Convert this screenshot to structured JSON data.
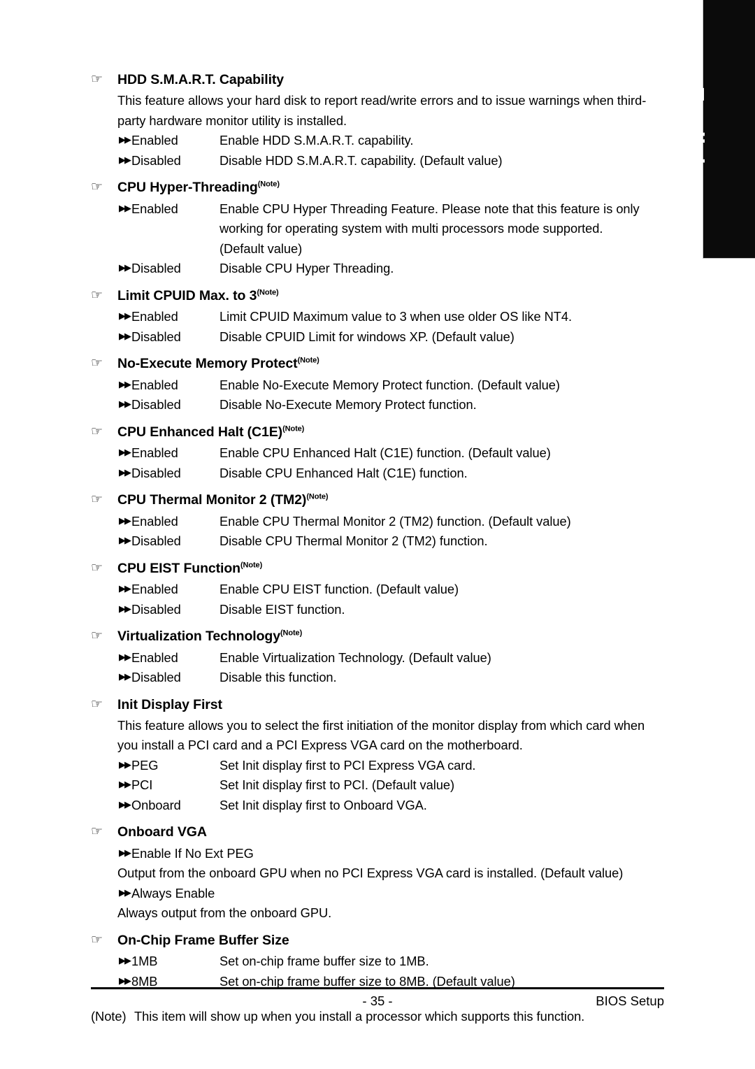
{
  "language_tab": {
    "label": "English"
  },
  "icons": {
    "manicule": "☞",
    "double_arrow": "▶▶"
  },
  "sections": [
    {
      "id": "hdd-smart-capability",
      "title": "HDD S.M.A.R.T. Capability",
      "note_marker": "",
      "paragraphs": [
        "This feature allows your hard disk to report read/write errors and to issue warnings when third-party hardware monitor utility is installed."
      ],
      "options": [
        {
          "label": "Enabled",
          "desc": "Enable HDD S.M.A.R.T. capability."
        },
        {
          "label": "Disabled",
          "desc": "Disable HDD S.M.A.R.T. capability. (Default value)"
        }
      ]
    },
    {
      "id": "cpu-hyper-threading",
      "title": "CPU Hyper-Threading",
      "note_marker": "(Note)",
      "paragraphs": [],
      "options": [
        {
          "label": "Enabled",
          "desc": "Enable CPU Hyper Threading Feature. Please note that this feature is only",
          "cont": [
            "working for operating system with multi processors mode supported.",
            "(Default value)"
          ]
        },
        {
          "label": "Disabled",
          "desc": "Disable CPU Hyper Threading."
        }
      ]
    },
    {
      "id": "limit-cpuid-max-to-3",
      "title": "Limit CPUID Max. to 3",
      "note_marker": "(Note)",
      "paragraphs": [],
      "options": [
        {
          "label": "Enabled",
          "desc": "Limit CPUID Maximum value to 3 when use older OS like NT4."
        },
        {
          "label": "Disabled",
          "desc": "Disable CPUID Limit for windows XP. (Default value)"
        }
      ]
    },
    {
      "id": "no-execute-memory-protect",
      "title": "No-Execute Memory Protect",
      "note_marker": "(Note)",
      "paragraphs": [],
      "options": [
        {
          "label": "Enabled",
          "desc": "Enable No-Execute Memory Protect function. (Default value)"
        },
        {
          "label": "Disabled",
          "desc": "Disable No-Execute Memory Protect function."
        }
      ]
    },
    {
      "id": "cpu-enhanced-halt-c1e",
      "title": "CPU Enhanced Halt (C1E)",
      "note_marker": "(Note)",
      "paragraphs": [],
      "options": [
        {
          "label": "Enabled",
          "desc": "Enable CPU Enhanced Halt (C1E) function. (Default value)"
        },
        {
          "label": "Disabled",
          "desc": "Disable CPU Enhanced Halt (C1E) function."
        }
      ]
    },
    {
      "id": "cpu-thermal-monitor-2-tm2",
      "title": "CPU Thermal Monitor 2 (TM2)",
      "note_marker": "(Note)",
      "paragraphs": [],
      "options": [
        {
          "label": "Enabled",
          "desc": "Enable CPU Thermal Monitor 2 (TM2) function. (Default value)"
        },
        {
          "label": "Disabled",
          "desc": "Disable CPU Thermal Monitor 2 (TM2) function."
        }
      ]
    },
    {
      "id": "cpu-eist-function",
      "title": "CPU EIST Function",
      "note_marker": "(Note)",
      "paragraphs": [],
      "options": [
        {
          "label": "Enabled",
          "desc": "Enable CPU EIST function. (Default value)"
        },
        {
          "label": "Disabled",
          "desc": "Disable EIST function."
        }
      ]
    },
    {
      "id": "virtualization-technology",
      "title": "Virtualization Technology",
      "note_marker": "(Note)",
      "paragraphs": [],
      "options": [
        {
          "label": "Enabled",
          "desc": "Enable Virtualization Technology. (Default value)"
        },
        {
          "label": "Disabled",
          "desc": "Disable this function."
        }
      ]
    },
    {
      "id": "init-display-first",
      "title": "Init Display First",
      "note_marker": "",
      "paragraphs": [
        "This feature allows you to select the first initiation of the monitor display from which card when you install a PCI card and a PCI Express VGA card on the motherboard."
      ],
      "options": [
        {
          "label": "PEG",
          "desc": "Set Init display first to PCI Express VGA card."
        },
        {
          "label": "PCI",
          "desc": "Set Init display first to PCI. (Default value)"
        },
        {
          "label": "Onboard",
          "desc": "Set Init display first to Onboard VGA."
        }
      ]
    },
    {
      "id": "onboard-vga",
      "title": "Onboard VGA",
      "note_marker": "",
      "paragraphs": [],
      "solo_options": [
        {
          "label": "Enable If No Ext PEG",
          "desc": "Output from the onboard GPU when no PCI Express VGA card is installed. (Default value)"
        },
        {
          "label": "Always Enable",
          "desc": "Always output from the onboard GPU."
        }
      ]
    },
    {
      "id": "on-chip-frame-buffer-size",
      "title": "On-Chip Frame Buffer Size",
      "note_marker": "",
      "paragraphs": [],
      "options": [
        {
          "label": "1MB",
          "desc": "Set on-chip frame buffer size to 1MB."
        },
        {
          "label": "8MB",
          "desc": "Set on-chip frame buffer size to 8MB. (Default value)"
        }
      ]
    }
  ],
  "footnote": {
    "tag": "(Note)",
    "text": "This item will show up when you install a processor which supports this function."
  },
  "footer": {
    "page_number": "- 35 -",
    "section_label": "BIOS Setup"
  },
  "colors": {
    "text": "#000000",
    "page_background": "#ffffff",
    "tab_background": "#0b0b0b",
    "tab_text": "#ffffff"
  }
}
